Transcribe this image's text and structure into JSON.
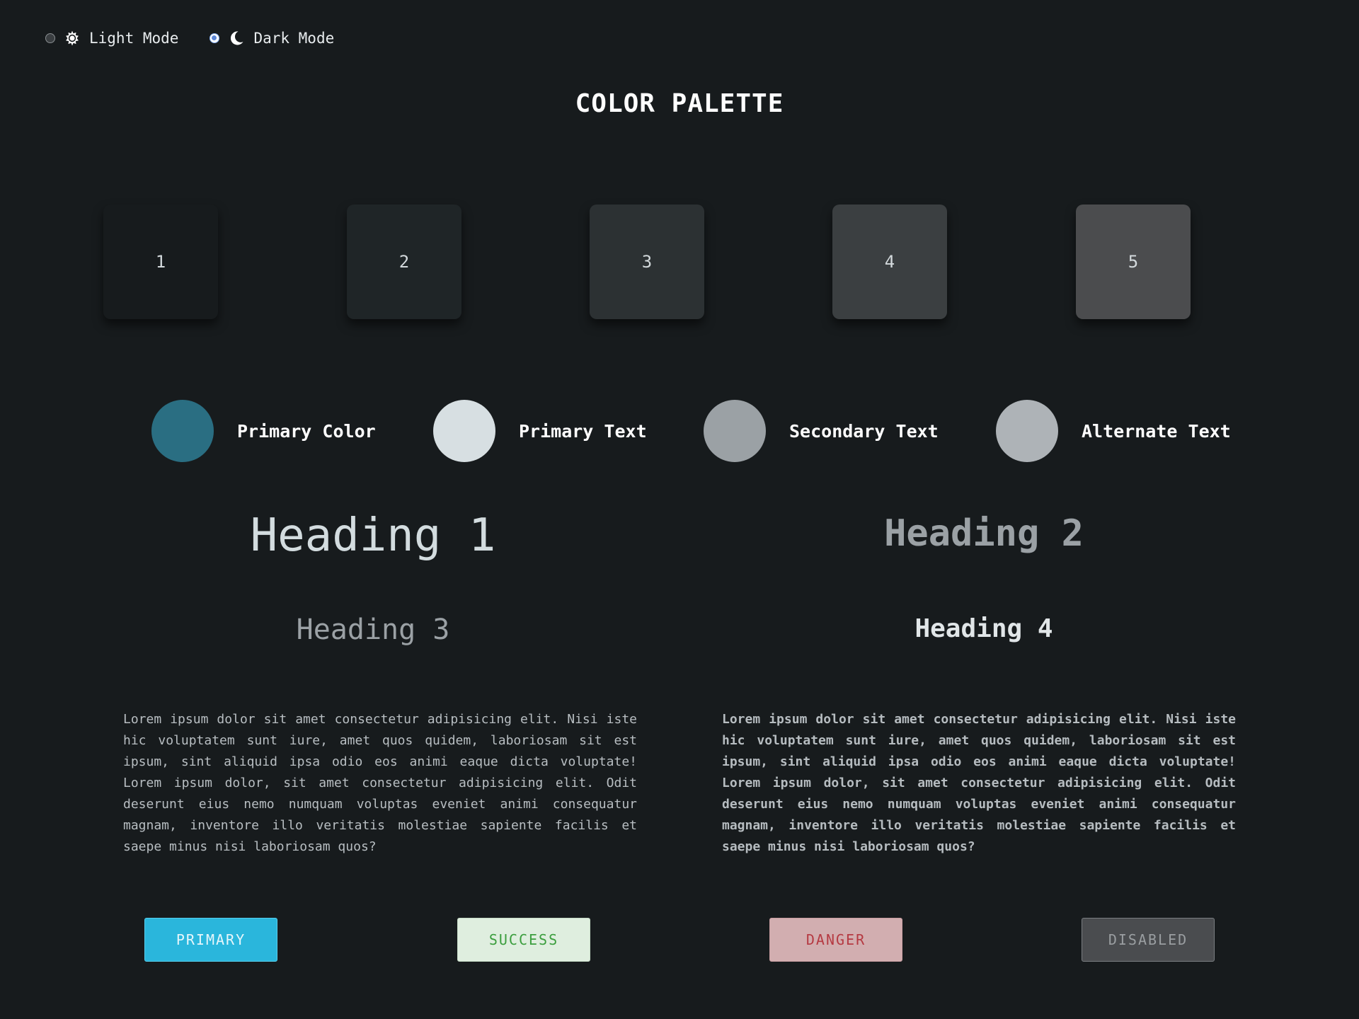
{
  "theme_toggle": {
    "light": {
      "label": "Light Mode",
      "selected": false
    },
    "dark": {
      "label": "Dark Mode",
      "selected": true
    }
  },
  "title": "COLOR PALETTE",
  "swatches": [
    {
      "label": "1",
      "color": "#171b1d"
    },
    {
      "label": "2",
      "color": "#1f2527"
    },
    {
      "label": "3",
      "color": "#2c3133"
    },
    {
      "label": "4",
      "color": "#3b3f41"
    },
    {
      "label": "5",
      "color": "#4b4c4e"
    }
  ],
  "legend": [
    {
      "label": "Primary Color",
      "color": "#2a6e82"
    },
    {
      "label": "Primary Text",
      "color": "#d7dfe2"
    },
    {
      "label": "Secondary Text",
      "color": "#9ba1a5"
    },
    {
      "label": "Alternate Text",
      "color": "#aeb3b7"
    }
  ],
  "headings": {
    "h1": "Heading 1",
    "h2": "Heading 2",
    "h3": "Heading 3",
    "h4": "Heading 4"
  },
  "paragraphs": {
    "normal": "Lorem ipsum dolor sit amet consectetur adipisicing elit. Nisi iste hic voluptatem sunt iure, amet quos quidem, laboriosam sit est ipsum, sint aliquid ipsa odio eos animi eaque dicta voluptate! Lorem ipsum dolor, sit amet consectetur adipisicing elit. Odit deserunt eius nemo numquam voluptas eveniet animi consequatur magnam, inventore illo veritatis molestiae sapiente facilis et saepe minus nisi laboriosam quos?",
    "bold": "Lorem ipsum dolor sit amet consectetur adipisicing elit. Nisi iste hic voluptatem sunt iure, amet quos quidem, laboriosam sit est ipsum, sint aliquid ipsa odio eos animi eaque dicta voluptate! Lorem ipsum dolor, sit amet consectetur adipisicing elit. Odit deserunt eius nemo numquam voluptas eveniet animi consequatur magnam, inventore illo veritatis molestiae sapiente facilis et saepe minus nisi laboriosam quos?"
  },
  "buttons": {
    "primary": "PRIMARY",
    "success": "SUCCESS",
    "danger": "DANGER",
    "disabled": "DISABLED"
  },
  "icons": {
    "light": "sun-icon",
    "dark": "moon-icon"
  }
}
